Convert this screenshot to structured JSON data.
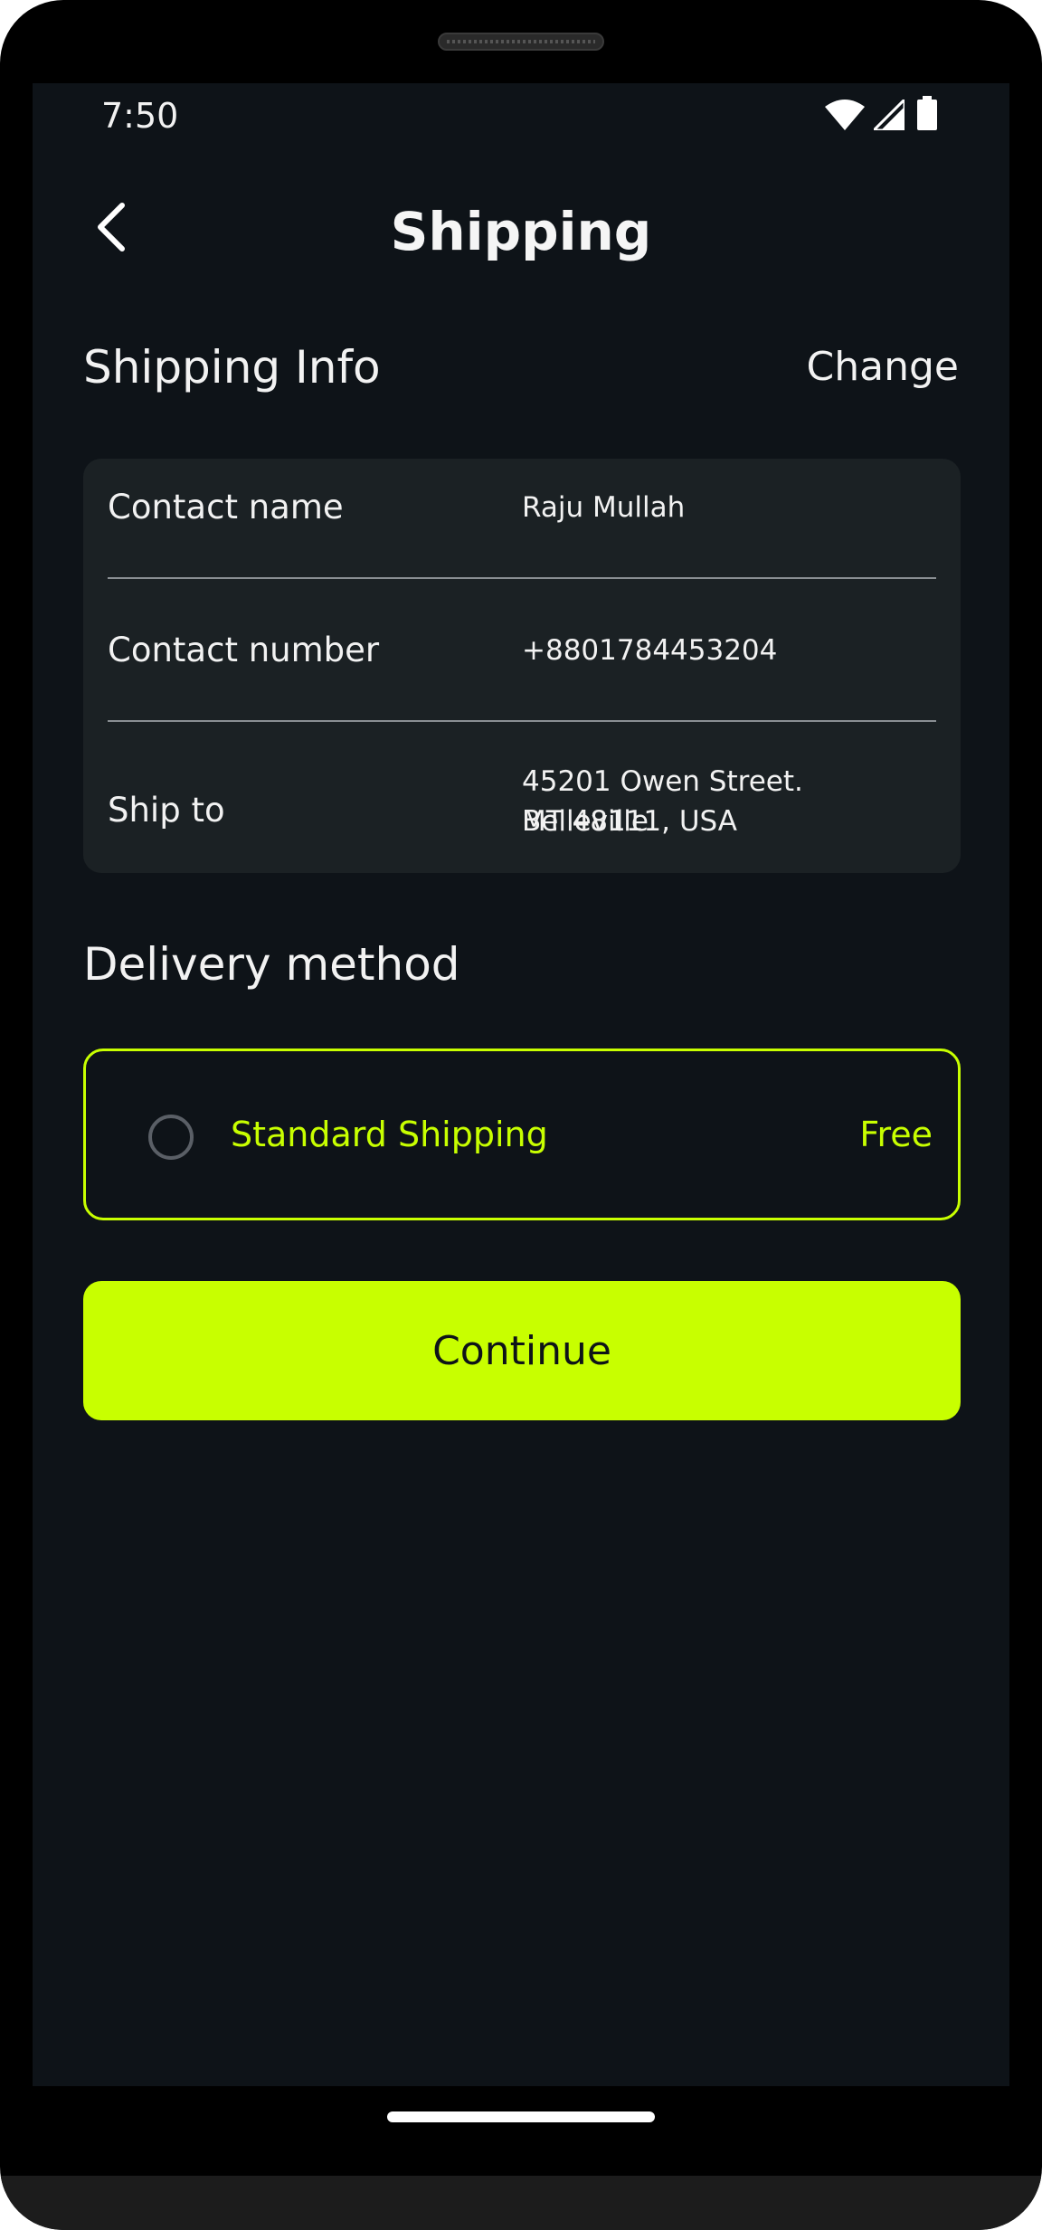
{
  "status_bar": {
    "time": "7:50",
    "icons": [
      "wifi-icon",
      "signal-icon",
      "battery-icon"
    ]
  },
  "header": {
    "title": "Shipping",
    "back_icon": "chevron-left-icon"
  },
  "shipping_info": {
    "heading": "Shipping Info",
    "change_label": "Change",
    "rows": [
      {
        "label": "Contact name",
        "value": "Raju Mullah"
      },
      {
        "label": "Contact number",
        "value": "+8801784453204"
      },
      {
        "label": "Ship to",
        "value_line1": "45201 Owen Street. Belleville",
        "value_line2": "MT 48111, USA"
      }
    ]
  },
  "delivery": {
    "heading": "Delivery method",
    "option_label": "Standard Shipping",
    "option_price": "Free",
    "selected": false
  },
  "continue_label": "Continue",
  "colors": {
    "background": "#0e1318",
    "card": "#1b2124",
    "accent": "#c8ff00",
    "text": "#f2f2f2"
  }
}
